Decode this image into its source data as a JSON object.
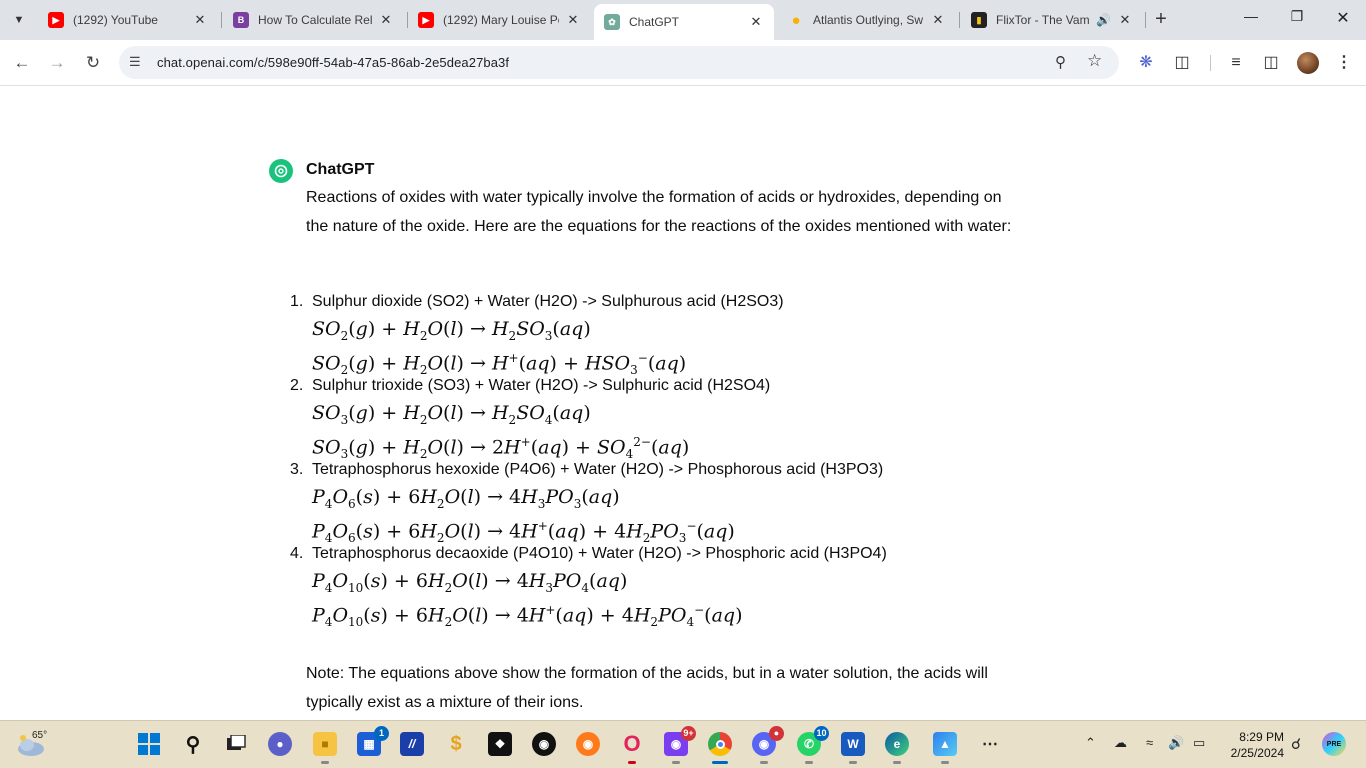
{
  "browser": {
    "tabs": [
      {
        "title": "(1292) YouTube",
        "favicon": "youtube-icon",
        "color": "#ff0000"
      },
      {
        "title": "How To Calculate Rela",
        "favicon": "b-icon",
        "color": "#7b3fa0"
      },
      {
        "title": "(1292) Mary Louise Pc",
        "favicon": "youtube-icon",
        "color": "#ff0000"
      },
      {
        "title": "ChatGPT",
        "favicon": "openai-icon",
        "color": "#74aa9c",
        "active": true
      },
      {
        "title": "Atlantis Outlying, Sw",
        "favicon": "lightbulb-icon",
        "color": "#f5b400"
      },
      {
        "title": "FlixTor - The Vam",
        "favicon": "flixtor-icon",
        "color": "#222222"
      }
    ],
    "url": "chat.openai.com/c/598e90ff-54ab-47a5-86ab-2e5dea27ba3f"
  },
  "chat": {
    "author": "ChatGPT",
    "intro": "Reactions of oxides with water typically involve the formation of acids or hydroxides, depending on the nature of the oxide. Here are the equations for the reactions of the oxides mentioned with water:",
    "reactions": [
      {
        "number": "1.",
        "title": "Sulphur dioxide (SO2) + Water (H2O) -> Sulphurous acid (H2SO3)"
      },
      {
        "number": "2.",
        "title": "Sulphur trioxide (SO3) + Water (H2O) -> Sulphuric acid (H2SO4)"
      },
      {
        "number": "3.",
        "title": "Tetraphosphorus hexoxide (P4O6) + Water (H2O) -> Phosphorous acid (H3PO3)"
      },
      {
        "number": "4.",
        "title": "Tetraphosphorus decaoxide (P4O10) + Water (H2O) -> Phosphoric acid (H3PO4)"
      }
    ],
    "note": "Note: The equations above show the formation of the acids, but in a water solution, the acids will typically exist as a mixture of their ions."
  },
  "taskbar": {
    "weather_temp": "65°",
    "time": "8:29 PM",
    "date": "2/25/2024",
    "badges": {
      "store": "1",
      "office": "9+",
      "whatsapp": "10"
    }
  }
}
